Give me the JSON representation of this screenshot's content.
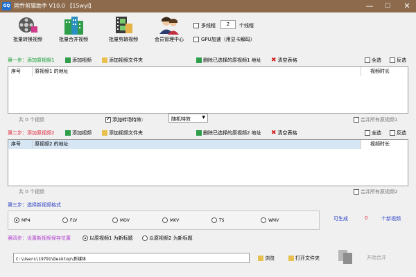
{
  "window": {
    "title": "固乔剪辑助手 V10.0 【15wyl】",
    "icon_text": "GQ",
    "min": "—",
    "max": "☐",
    "close": "✕"
  },
  "toolbar": {
    "items": [
      {
        "label": "批量转换视频",
        "icon": "film-reel-icon"
      },
      {
        "label": "批量合并视频",
        "icon": "building-icon"
      },
      {
        "label": "批量剪辑视频",
        "icon": "film-strip-icon"
      },
      {
        "label": "会员管理中心",
        "icon": "users-icon"
      }
    ],
    "multithread_label": "多线程",
    "thread_count": "2",
    "thread_unit": "个线程",
    "gpu_label": "GPU加速（用显卡解码）"
  },
  "step1": {
    "title": "第一步：添加原视频1",
    "add_video": "添加视频",
    "add_folder": "添加视频文件夹",
    "delete_selected": "删除已选择的原视频1 地址",
    "clear": "清空表格",
    "select_all": "全选",
    "invert": "反选",
    "col_index": "序号",
    "col_path": "原视频1 的地址",
    "col_duration": "视频时长",
    "count": "共 0 个视频",
    "transition_label": "添加转场特效:",
    "transition_value": "随机特效",
    "merge_label": "合并所有原视频1"
  },
  "step2": {
    "title": "第二步：添加原视频2",
    "add_video": "添加视频",
    "add_folder": "添加视频文件夹",
    "delete_selected": "删除已选择的原视频2 地址",
    "clear": "清空表格",
    "select_all": "全选",
    "invert": "反选",
    "col_index": "序号",
    "col_path": "原视频2 的地址",
    "col_duration": "视频时长",
    "count": "共 0 个视频",
    "merge_label": "合并所有原视频2"
  },
  "step3": {
    "title": "第三步：选择新视频格式",
    "formats": [
      "MP4",
      "FLV",
      "MOV",
      "MKV",
      "TS",
      "WMV"
    ],
    "selected": "MP4",
    "generated_label": "可生成",
    "generated_count": "0",
    "generated_unit": "个新视频"
  },
  "step4": {
    "title": "第四步：设置新视频保存位置",
    "option1": "以原视频1 为新标题",
    "option2": "以原视频2 为新标题",
    "path": "C:\\Users\\19791\\Desktop\\新媒体",
    "browse": "浏览",
    "open_folder": "打开文件夹",
    "start": "开始合并"
  },
  "colors": {
    "titlebar": "#8c6a4b",
    "step1": "#0a9a2a",
    "step2": "#e0283c",
    "step3": "#2a3fc4",
    "step4": "#b03bd0",
    "generated": "#e0283c"
  }
}
